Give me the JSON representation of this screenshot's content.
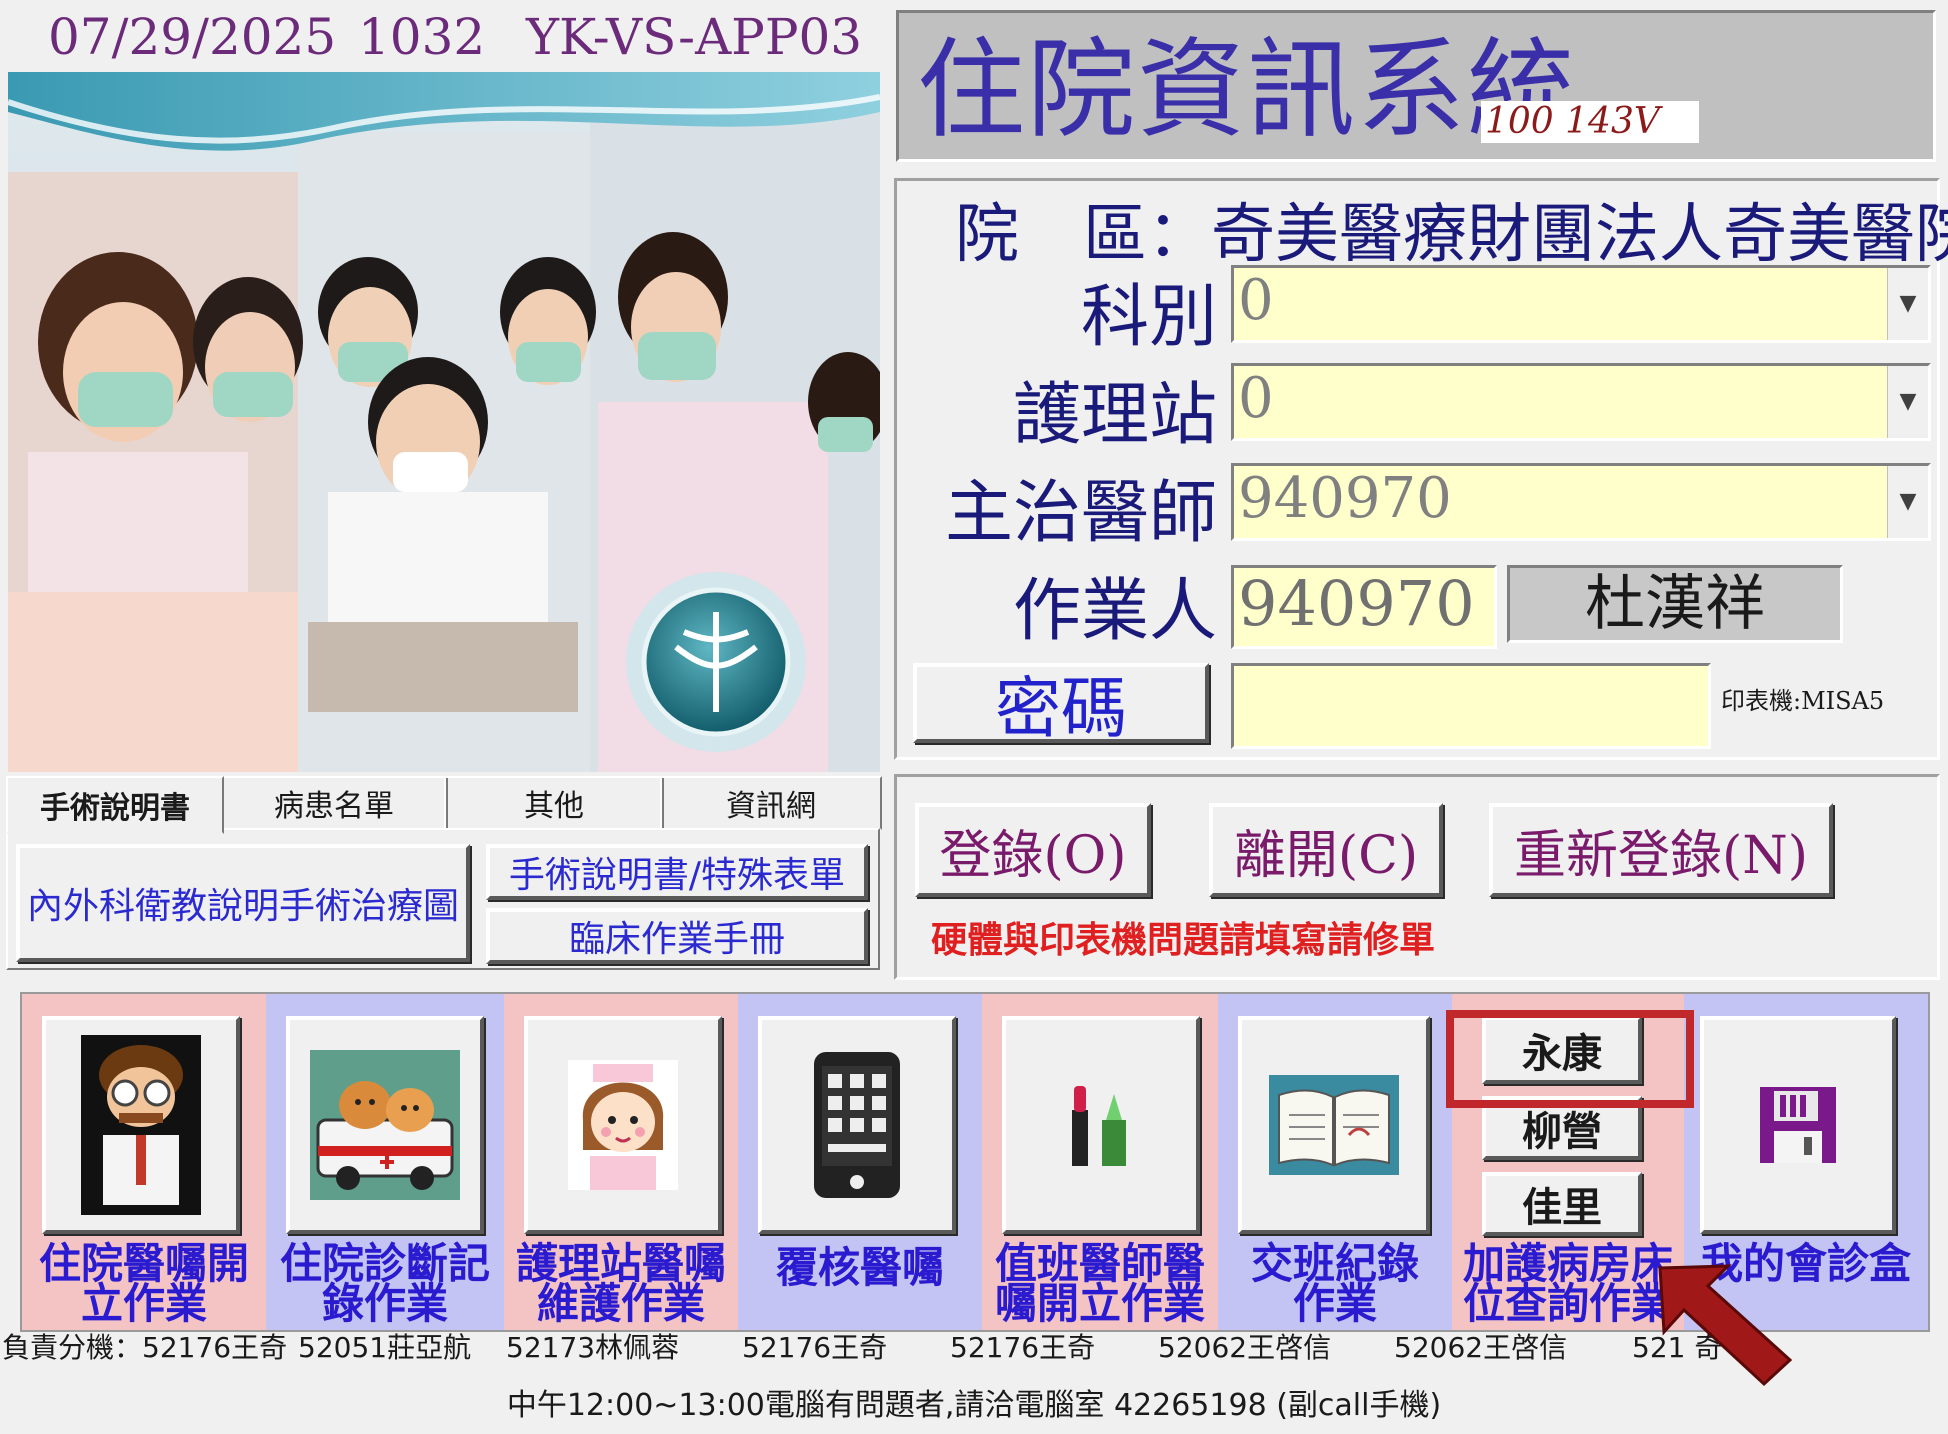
{
  "header": {
    "date": "07/29/2025",
    "code": "1032",
    "host": "YK-VS-APP03"
  },
  "title": {
    "text": "住院資訊系統",
    "version": "100 143V"
  },
  "login": {
    "hospital_label": "院　區：",
    "hospital_name": "奇美醫療財團法人奇美醫院",
    "dept_label": "科別",
    "dept_value": "0",
    "station_label": "護理站",
    "station_value": "0",
    "doctor_label": "主治醫師",
    "doctor_value": "940970",
    "operator_label": "作業人",
    "operator_value": "940970",
    "operator_name": "杜漢祥",
    "password_button": "密碼",
    "password_value": "",
    "printer": "印表機:MISA5"
  },
  "actions": {
    "login_button": "登錄(O)",
    "exit_button": "離開(C)",
    "relogin_button": "重新登錄(N)",
    "notice": "硬體與印表機問題請填寫請修單"
  },
  "tabs": [
    "手術說明書",
    "病患名單",
    "其他",
    "資訊網"
  ],
  "tab_content": {
    "btn_left": "內外科衛教說明手術治療圖",
    "btn_right_top": "手術說明書/特殊表單",
    "btn_right_bottom": "臨床作業手冊"
  },
  "modules": [
    {
      "label1": "住院醫囑開",
      "label2": "立作業",
      "icon": "doctor-icon",
      "ext": "負責分機：52176王奇"
    },
    {
      "label1": "住院診斷記",
      "label2": "錄作業",
      "icon": "ambulance-dogs-icon",
      "ext": "52051莊亞航"
    },
    {
      "label1": "護理站醫囑",
      "label2": "維護作業",
      "icon": "nurse-icon",
      "ext": "52173林佩蓉"
    },
    {
      "label1": "覆核醫囑",
      "label2": "",
      "icon": "mobile-phone-icon",
      "ext": "52176王奇"
    },
    {
      "label1": "值班醫師醫",
      "label2": "囑開立作業",
      "icon": "lipstick-icon",
      "ext": "52176王奇"
    },
    {
      "label1": "交班紀錄",
      "label2": "作業",
      "icon": "open-book-icon",
      "ext": "52062王啓信"
    },
    {
      "label1": "加護病房床",
      "label2": "位查詢作業",
      "icon": "",
      "ext": "52062王啓信"
    },
    {
      "label1": "我的會診盒",
      "label2": "",
      "icon": "floppy-disk-icon",
      "ext": "521 奇"
    }
  ],
  "campus_buttons": [
    "永康",
    "柳營",
    "佳里"
  ],
  "footer": "中午12:00~13:00電腦有問題者,請洽電腦室 42265198 (副call手機)",
  "colors": {
    "pink": "#f4c4c4",
    "lavender": "#c4c4f4",
    "highlight": "#c0282c",
    "arrow": "#a01818"
  }
}
